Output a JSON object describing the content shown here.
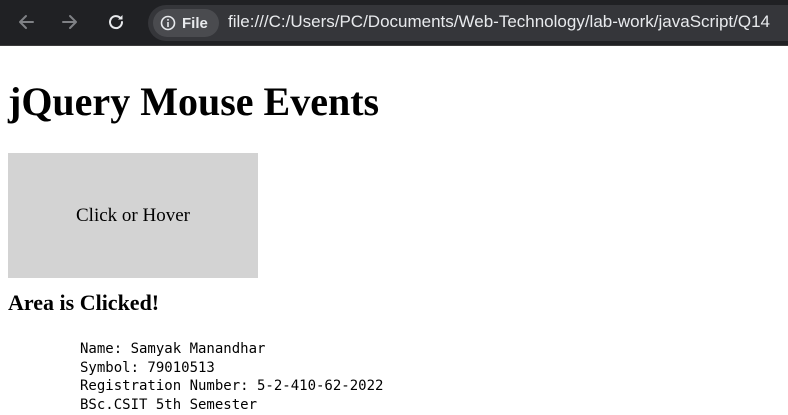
{
  "browser": {
    "site_chip_label": "File",
    "url": "file:///C:/Users/PC/Documents/Web-Technology/lab-work/javaScript/Q14"
  },
  "page": {
    "title": "jQuery Mouse Events",
    "area_label": "Click or Hover",
    "status": "Area is Clicked!",
    "info": [
      "Name: Samyak Manandhar",
      "Symbol: 79010513",
      "Registration Number: 5-2-410-62-2022",
      "BSc.CSIT 5th Semester"
    ]
  },
  "colors": {
    "toolbar_bg": "#202124",
    "omnibox_bg": "#35363a",
    "area_bg": "#d3d3d3"
  },
  "icons": {
    "back": "arrow-left-icon",
    "forward": "arrow-right-icon",
    "reload": "reload-icon",
    "info": "info-icon"
  }
}
